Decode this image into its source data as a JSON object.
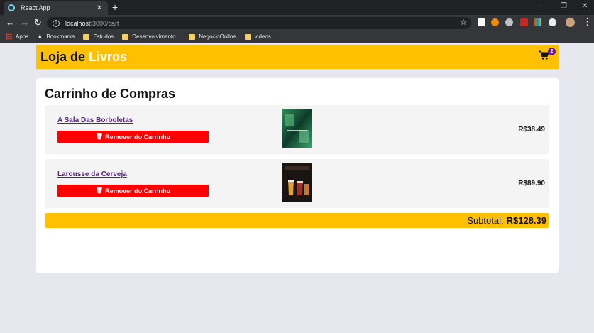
{
  "browser": {
    "tab_title": "React App",
    "tab_close": "✕",
    "new_tab": "+",
    "url_host": "localhost",
    "url_path": ":3000/cart",
    "bookmarks": [
      "Apps",
      "Bookmarks",
      "Estudos",
      "Desenvolvimento...",
      "NegocioOnline",
      "videos"
    ]
  },
  "header": {
    "brand_part1": "Loja de ",
    "brand_part2": "Livros",
    "cart_count": "2"
  },
  "cart": {
    "title": "Carrinho de Compras",
    "remove_label": "Remover do Carrinho",
    "items": [
      {
        "name": "A Sala Das Borboletas",
        "price": "R$38.49"
      },
      {
        "name": "Larousse da Cerveja",
        "price": "R$89.90"
      }
    ],
    "subtotal_label": "Subtotal:",
    "subtotal_value": "R$128.39"
  },
  "colors": {
    "accent": "#ffc000",
    "remove": "#ff0000",
    "link": "#5a1f8a",
    "badge": "#6a1b9a"
  },
  "icons": [
    "react-icon",
    "back-arrow-icon",
    "forward-arrow-icon",
    "reload-icon",
    "info-icon",
    "star-icon",
    "cart-icon",
    "trash-icon"
  ]
}
